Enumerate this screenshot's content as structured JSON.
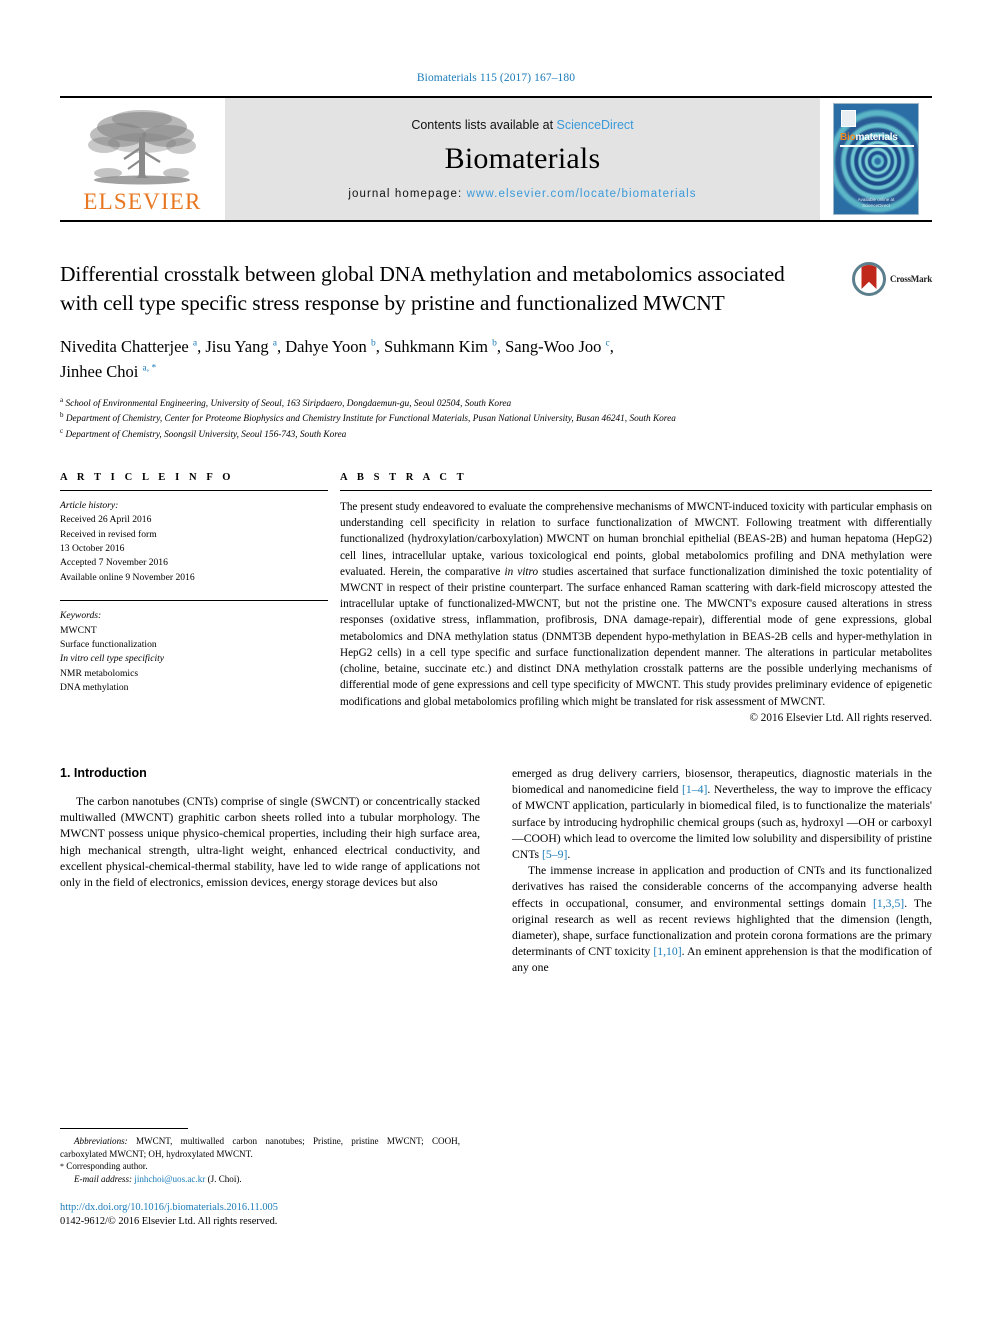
{
  "running_head": "Biomaterials 115 (2017) 167–180",
  "banner": {
    "publisher_logo_text": "ELSEVIER",
    "contents_prefix": "Contents lists available at ",
    "contents_link": "ScienceDirect",
    "journal_name": "Biomaterials",
    "homepage_prefix": "journal homepage: ",
    "homepage_url": "www.elsevier.com/locate/biomaterials",
    "cover": {
      "title_first": "Bio",
      "title_rest": "materials",
      "footer_line1": "Available online at",
      "footer_line2": "ScienceDirect"
    },
    "colors": {
      "link_blue": "#3a9ad9",
      "elsevier_orange": "#E87722",
      "banner_gray": "#e3e3e3"
    }
  },
  "article": {
    "title": "Differential crosstalk between global DNA methylation and metabolomics associated with cell type specific stress response by pristine and functionalized MWCNT",
    "crossmark_label": "CrossMark",
    "authors": [
      {
        "name": "Nivedita Chatterjee",
        "marks": "a"
      },
      {
        "name": "Jisu Yang",
        "marks": "a"
      },
      {
        "name": "Dahye Yoon",
        "marks": "b"
      },
      {
        "name": "Suhkmann Kim",
        "marks": "b"
      },
      {
        "name": "Sang-Woo Joo",
        "marks": "c"
      },
      {
        "name": "Jinhee Choi",
        "marks": "a, *"
      }
    ],
    "affiliations": [
      {
        "mark": "a",
        "text": "School of Environmental Engineering, University of Seoul, 163 Siripdaero, Dongdaemun-gu, Seoul 02504, South Korea"
      },
      {
        "mark": "b",
        "text": "Department of Chemistry, Center for Proteome Biophysics and Chemistry Institute for Functional Materials, Pusan National University, Busan 46241, South Korea"
      },
      {
        "mark": "c",
        "text": "Department of Chemistry, Soongsil University, Seoul 156-743, South Korea"
      }
    ]
  },
  "article_info": {
    "heading": "A R T I C L E   I N F O",
    "history_label": "Article history:",
    "history": [
      "Received 26 April 2016",
      "Received in revised form",
      "13 October 2016",
      "Accepted 7 November 2016",
      "Available online 9 November 2016"
    ],
    "keywords_label": "Keywords:",
    "keywords": [
      "MWCNT",
      "Surface functionalization",
      "In vitro cell type specificity",
      "NMR metabolomics",
      "DNA methylation"
    ]
  },
  "abstract": {
    "heading": "A B S T R A C T",
    "text_part1": "The present study endeavored to evaluate the comprehensive mechanisms of MWCNT-induced toxicity with particular emphasis on understanding cell specificity in relation to surface functionalization of MWCNT. Following treatment with differentially functionalized (hydroxylation/carboxylation) MWCNT on human bronchial epithelial (BEAS-2B) and human hepatoma (HepG2) cell lines, intracellular uptake, various toxicological end points, global metabolomics profiling and DNA methylation were evaluated. Herein, the comparative ",
    "italic1": "in vitro",
    "text_part2": " studies ascertained that surface functionalization diminished the toxic potentiality of MWCNT in respect of their pristine counterpart. The surface enhanced Raman scattering with dark-field microscopy attested the intracellular uptake of functionalized-MWCNT, but not the pristine one. The MWCNT's exposure caused alterations in stress responses (oxidative stress, inflammation, profibrosis, DNA damage-repair), differential mode of gene expressions, global metabolomics and DNA methylation status (DNMT3B dependent hypo-methylation in BEAS-2B cells and hyper-methylation in HepG2 cells) in a cell type specific and surface functionalization dependent manner. The alterations in particular metabolites (choline, betaine, succinate etc.) and distinct DNA methylation crosstalk patterns are the possible underlying mechanisms of differential mode of gene expressions and cell type specificity of MWCNT. This study provides preliminary evidence of epigenetic modifications and global metabolomics profiling which might be translated for risk assessment of MWCNT.",
    "copyright": "© 2016 Elsevier Ltd. All rights reserved."
  },
  "introduction": {
    "section_number_title": "1.  Introduction",
    "left_paragraph": "The carbon nanotubes (CNTs) comprise of single (SWCNT) or concentrically stacked multiwalled (MWCNT) graphitic carbon sheets rolled into a tubular morphology. The MWCNT possess unique physico-chemical properties, including their high surface area, high mechanical strength, ultra-light weight, enhanced electrical conductivity, and excellent physical-chemical-thermal stability, have led to wide range of applications not only in the field of electronics, emission devices, energy storage devices but also",
    "right_para1_a": "emerged as drug delivery carriers, biosensor, therapeutics, diagnostic materials in the biomedical and nanomedicine field ",
    "right_para1_cite1": "[1–4]",
    "right_para1_b": ". Nevertheless, the way to improve the efficacy of MWCNT application, particularly in biomedical filed, is to functionalize the materials' surface by introducing hydrophilic chemical groups (such as, hydroxyl —OH or carboxyl —COOH) which lead to overcome the limited low solubility and dispersibility of pristine CNTs ",
    "right_para1_cite2": "[5–9]",
    "right_para1_c": ".",
    "right_para2_a": "The immense increase in application and production of CNTs and its functionalized derivatives has raised the considerable concerns of the accompanying adverse health effects in occupational, consumer, and environmental settings domain ",
    "right_para2_cite1": "[1,3,5]",
    "right_para2_b": ". The original research as well as recent reviews highlighted that the dimension (length, diameter), shape, surface functionalization and protein corona formations are the primary determinants of CNT toxicity ",
    "right_para2_cite2": "[1,10]",
    "right_para2_c": ". An eminent apprehension is that the modification of any one"
  },
  "footnotes": {
    "abbreviations_label": "Abbreviations:",
    "abbreviations_text": " MWCNT, multiwalled carbon nanotubes; Pristine, pristine MWCNT; COOH, carboxylated MWCNT; OH, hydroxylated MWCNT.",
    "corresponding_mark": "*",
    "corresponding_text": " Corresponding author.",
    "email_label": "E-mail address:",
    "email": "jinhchoi@uos.ac.kr",
    "email_suffix": " (J. Choi).",
    "doi": "http://dx.doi.org/10.1016/j.biomaterials.2016.11.005",
    "issn_line": "0142-9612/© 2016 Elsevier Ltd. All rights reserved."
  }
}
